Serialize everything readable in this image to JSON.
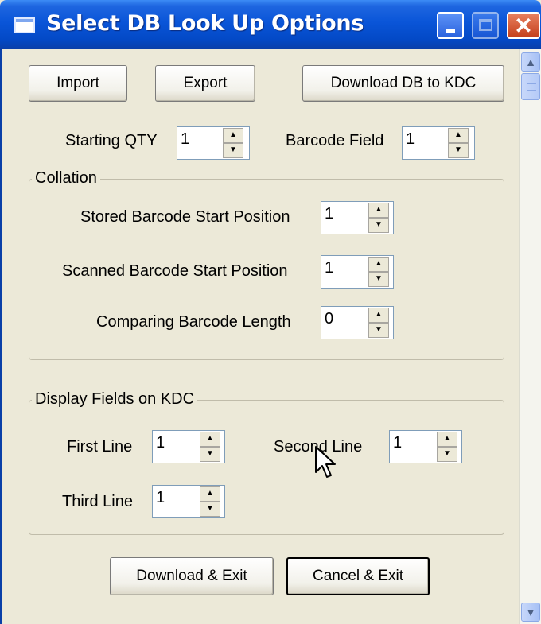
{
  "window": {
    "title": "Select DB Look Up Options",
    "close_glyph": "✕"
  },
  "toolbar": {
    "import_label": "Import",
    "export_label": "Export",
    "download_db_label": "Download DB to KDC"
  },
  "options": {
    "starting_qty_label": "Starting QTY",
    "starting_qty_value": "1",
    "barcode_field_label": "Barcode Field",
    "barcode_field_value": "1"
  },
  "collation": {
    "legend": "Collation",
    "stored_start_label": "Stored Barcode Start Position",
    "stored_start_value": "1",
    "scanned_start_label": "Scanned Barcode Start Position",
    "scanned_start_value": "1",
    "compare_length_label": "Comparing Barcode Length",
    "compare_length_value": "0"
  },
  "display_fields": {
    "legend": "Display Fields on KDC",
    "first_line_label": "First Line",
    "first_line_value": "1",
    "second_line_label": "Second Line",
    "second_line_value": "1",
    "third_line_label": "Third Line",
    "third_line_value": "1"
  },
  "footer": {
    "download_exit_label": "Download & Exit",
    "cancel_exit_label": "Cancel & Exit"
  },
  "icons": {
    "up_arrow": "▲",
    "down_arrow": "▼"
  },
  "colors": {
    "titlebar": "#0A55D8",
    "dialog_bg": "#ECE9D8",
    "close_button": "#C4401C"
  }
}
